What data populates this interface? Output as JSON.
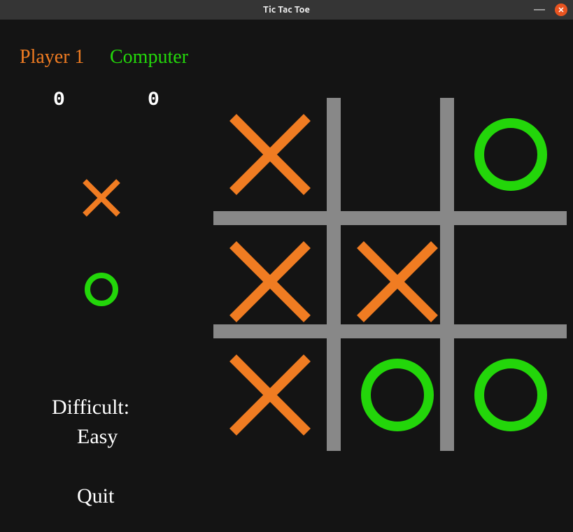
{
  "window": {
    "title": "Tic Tac Toe"
  },
  "players": {
    "p1_label": "Player 1",
    "p2_label": "Computer",
    "p1_score": "0",
    "p2_score": "0"
  },
  "difficulty": {
    "label": "Difficult:",
    "value": "Easy"
  },
  "actions": {
    "quit": "Quit"
  },
  "board": {
    "cells": [
      [
        "X",
        "",
        "O"
      ],
      [
        "X",
        "X",
        ""
      ],
      [
        "X",
        "O",
        "O"
      ]
    ]
  },
  "colors": {
    "x": "#f07c22",
    "o": "#23d60a",
    "grid": "#888888",
    "bg": "#141414"
  }
}
